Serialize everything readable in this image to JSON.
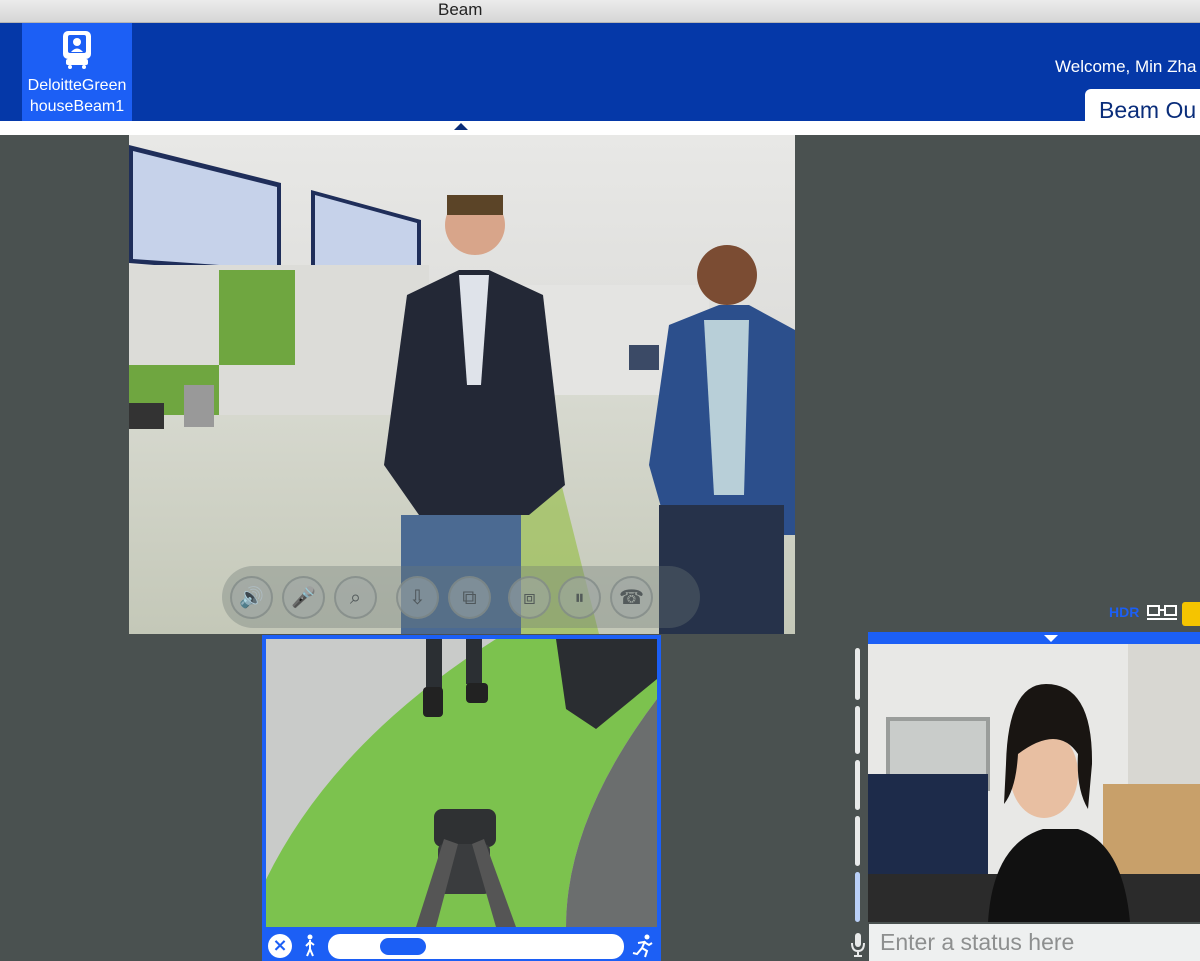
{
  "window": {
    "title": "Beam"
  },
  "header": {
    "robot_name": "DeloitteGreenhouseBeam1",
    "robot_name_line1": "DeloitteGreen",
    "robot_name_line2": "houseBeam1",
    "welcome": "Welcome, Min Zha",
    "beam_out_label": "Beam Ou"
  },
  "main_video": {
    "toolbar": [
      {
        "icon": "speaker-icon",
        "glyph": "🔊"
      },
      {
        "icon": "microphone-icon",
        "glyph": "🎤"
      },
      {
        "icon": "zoom-icon",
        "glyph": "⌕"
      },
      {
        "icon": "photo-download-icon",
        "glyph": "⇩"
      },
      {
        "icon": "screen-share-icon",
        "glyph": "⧉"
      },
      {
        "icon": "swap-camera-icon",
        "glyph": "⧈"
      },
      {
        "icon": "pause-icon",
        "glyph": "⏸"
      },
      {
        "icon": "hang-up-icon",
        "glyph": "☎"
      }
    ]
  },
  "drive": {
    "speed_fraction": 0.2
  },
  "status_icons": {
    "hdr_label": "HDR"
  },
  "self_view": {
    "status_placeholder": "Enter a status here",
    "mic_level_fraction": 0.15
  },
  "colors": {
    "accent": "#1c5ff5",
    "header_bg": "#0538a8",
    "background": "#4a5150",
    "battery": "#f5c400"
  }
}
